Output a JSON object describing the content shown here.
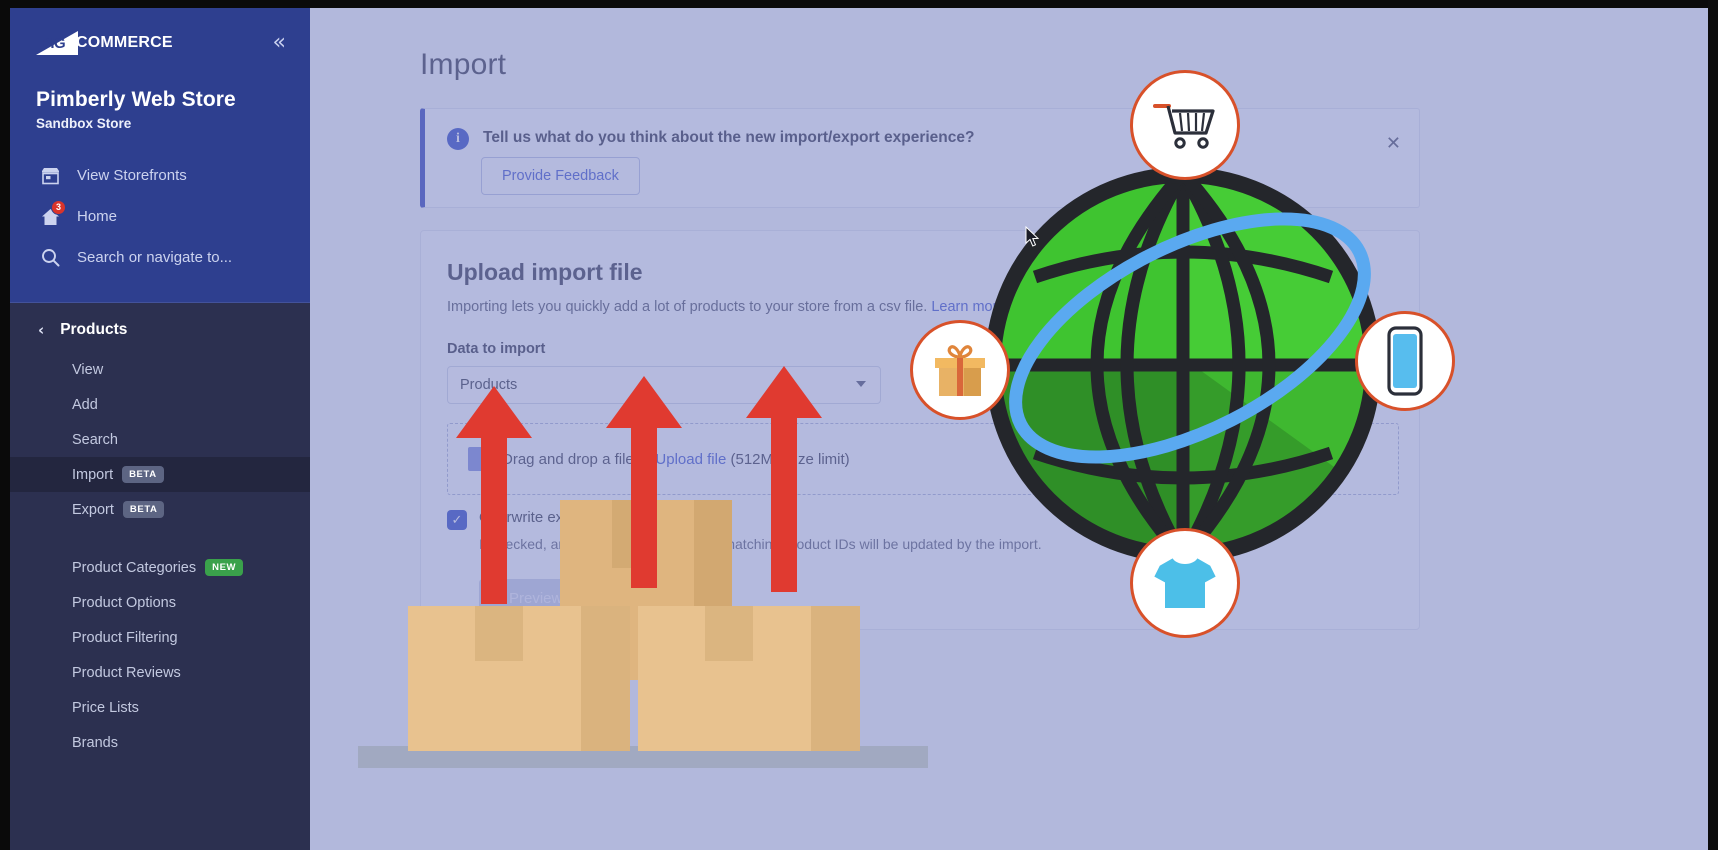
{
  "sidebar": {
    "logo": {
      "big": "BIG",
      "commerce": "COMMERCE"
    },
    "collapse_icon": "«",
    "store_name": "Pimberly Web Store",
    "store_subtitle": "Sandbox Store",
    "top_links": [
      {
        "label": "View Storefronts",
        "icon": "storefront-icon",
        "badge": ""
      },
      {
        "label": "Home",
        "icon": "home-icon",
        "badge": "3"
      },
      {
        "label": "Search or navigate to...",
        "icon": "search-icon",
        "badge": ""
      }
    ],
    "section": {
      "label": "Products",
      "back_icon": "chevron-left-icon"
    },
    "items": [
      {
        "label": "View",
        "tag": "",
        "active": false
      },
      {
        "label": "Add",
        "tag": "",
        "active": false
      },
      {
        "label": "Search",
        "tag": "",
        "active": false
      },
      {
        "label": "Import",
        "tag": "BETA",
        "active": true
      },
      {
        "label": "Export",
        "tag": "BETA",
        "active": false
      }
    ],
    "items2": [
      {
        "label": "Product Categories",
        "tag": "NEW"
      },
      {
        "label": "Product Options",
        "tag": ""
      },
      {
        "label": "Product Filtering",
        "tag": ""
      },
      {
        "label": "Product Reviews",
        "tag": ""
      },
      {
        "label": "Price Lists",
        "tag": ""
      },
      {
        "label": "Brands",
        "tag": ""
      }
    ]
  },
  "main": {
    "page_title": "Import",
    "banner": {
      "info_icon": "i",
      "message": "Tell us what do you think about the new import/export experience?",
      "button_label": "Provide Feedback",
      "close_icon": "✕"
    },
    "card": {
      "title": "Upload import file",
      "description": "Importing lets you quickly add a lot of products to your store from a csv file.",
      "description_link": "Learn more",
      "field_label": "Data to import",
      "select_value": "Products",
      "dropzone_text_before": "Drag and drop a file or ",
      "dropzone_link": "Upload file",
      "dropzone_text_after": " (512MB size limit)",
      "checkbox_checked": true,
      "checkbox_label": "Overwrite existing products",
      "checkbox_description": "If checked, any products in the file with matching product IDs will be updated by the import.",
      "preview_button": "Preview"
    }
  },
  "illustration": {
    "globe_colors": {
      "light": "#3fc430",
      "mid": "#3aaf2e",
      "dark": "#2f8f27",
      "bright": "#57e83f",
      "grid": "#24262b"
    },
    "orbit_color": "#5aa9f0",
    "icon_ring_color": "#d8512a",
    "icons": [
      {
        "name": "shopping-cart-icon",
        "position": "top"
      },
      {
        "name": "gift-box-icon",
        "position": "left"
      },
      {
        "name": "mobile-phone-icon",
        "position": "right"
      },
      {
        "name": "t-shirt-icon",
        "position": "bottom"
      }
    ],
    "arrow_color": "#e03a30",
    "arrow_count": 3,
    "box_color": "#e8c28f"
  }
}
